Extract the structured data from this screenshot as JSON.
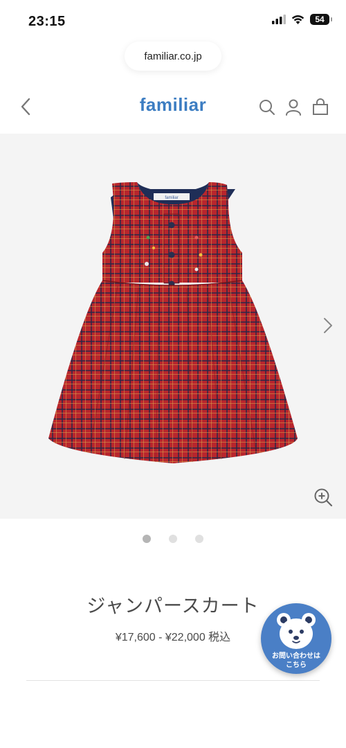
{
  "status_bar": {
    "time": "23:15",
    "battery": "54"
  },
  "browser": {
    "url": "familiar.co.jp"
  },
  "header": {
    "logo": "familiar"
  },
  "product": {
    "image_brand_tag": "familiar",
    "title": "ジャンパースカート",
    "price": "¥17,600 - ¥22,000 税込",
    "carousel": {
      "count": 3,
      "active_index": 0
    }
  },
  "contact": {
    "label": "お問い合わせは\nこちら"
  },
  "colors": {
    "brand_blue": "#3c7dc2",
    "fab_blue": "#4a7fc6",
    "dress_red": "#b8262d",
    "dress_navy": "#1f2e57"
  },
  "icons": [
    "signal-icon",
    "wifi-icon",
    "battery-icon",
    "back-icon",
    "search-icon",
    "account-icon",
    "cart-icon",
    "next-arrow-icon",
    "zoom-in-icon",
    "bear-mascot-icon"
  ]
}
